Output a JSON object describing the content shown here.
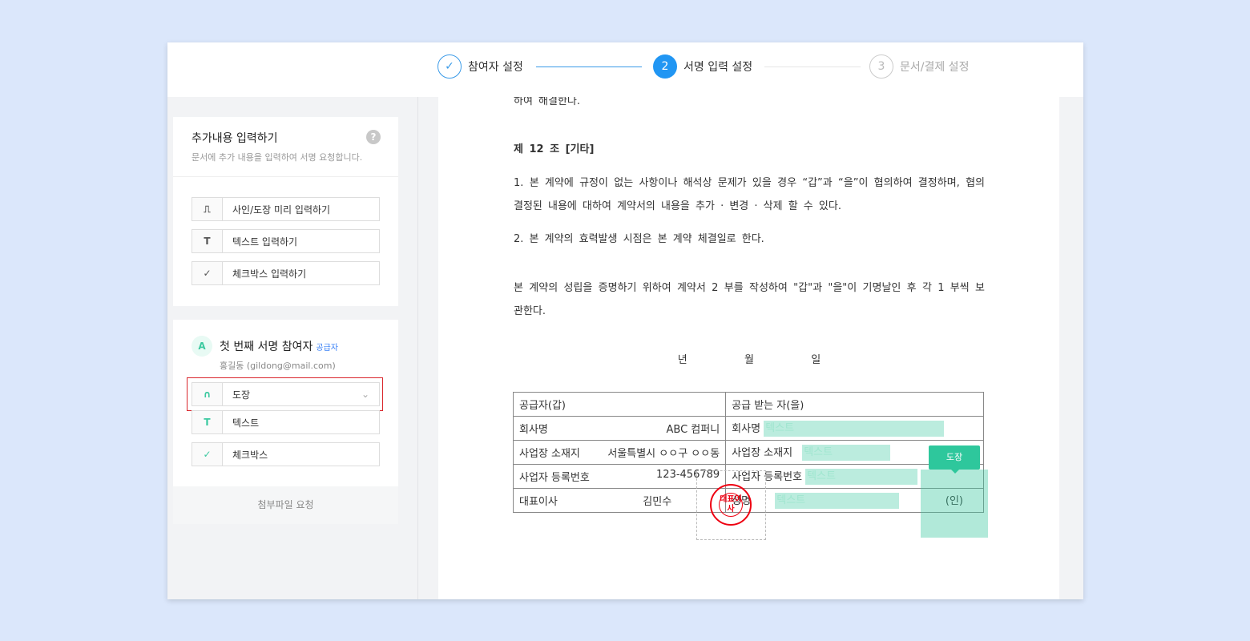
{
  "steps": [
    {
      "num": "✓",
      "label": "참여자 설정"
    },
    {
      "num": "2",
      "label": "서명 입력 설정"
    },
    {
      "num": "3",
      "label": "문서/결제 설정"
    }
  ],
  "panel1": {
    "title": "추가내용 입력하기",
    "subtitle": "문서에 추가 내용을 입력하여 서명 요청합니다.",
    "help": "?",
    "buttons": [
      {
        "icon": "stamp-icon",
        "glyph": "🔒︎",
        "label": "사인/도장 미리 입력하기"
      },
      {
        "icon": "text-icon",
        "glyph": "T",
        "label": "텍스트 입력하기"
      },
      {
        "icon": "check-icon",
        "glyph": "✓",
        "label": "체크박스 입력하기"
      }
    ]
  },
  "panel2": {
    "avatar": "A",
    "name": "첫 번째 서명 참여자",
    "role": "공급자",
    "email": "홍길동 (gildong@mail.com)",
    "fields": [
      {
        "glyph": "∩",
        "label": "도장",
        "caret": "⌄"
      },
      {
        "glyph": "T",
        "label": "텍스트"
      },
      {
        "glyph": "✓",
        "label": "체크박스"
      }
    ],
    "footer": "첨부파일 요청"
  },
  "doc": {
    "line0": "하여 해결한다.",
    "article": "제 12 조 [기타]",
    "p1": "1. 본 계약에 규정이 없는 사항이나 해석상 문제가 있을 경우 “갑”과 “을”이 협의하여 결정하며, 협의 결정된 내용에 대하여 계약서의 내용을 추가 · 변경 · 삭제 할 수 있다.",
    "p2": "2. 본 계약의 효력발생 시점은 본 계약 체결일로 한다.",
    "p3": "본 계약의 성립을 증명하기 위하여 계약서 2 부를 작성하여 \"갑\"과 \"을\"이 기명날인 후 각 1 부씩 보관한다.",
    "date": "년          월          일",
    "table": {
      "h1": "공급자(갑)",
      "h2": "공급 받는 자(을)",
      "rows": [
        {
          "l": "회사명",
          "v": "ABC 컴퍼니",
          "r": "회사명"
        },
        {
          "l": "사업장 소재지",
          "v": "서울특별시 ㅇㅇ구 ㅇㅇ동",
          "r": "사업장 소재지"
        },
        {
          "l": "사업자 등록번호",
          "v": "123-456789",
          "r": "사업자 등록번호"
        },
        {
          "l": "대표이사",
          "v": "김민수",
          "r": "성명"
        }
      ],
      "placeholder": "텍스트",
      "seal_mark": "(인)"
    },
    "seal_text": "대표이사",
    "tooltip": "도장"
  },
  "colors": {
    "accent": "#2196f3",
    "green": "#2ec79c",
    "highlight": "#d9262c"
  }
}
